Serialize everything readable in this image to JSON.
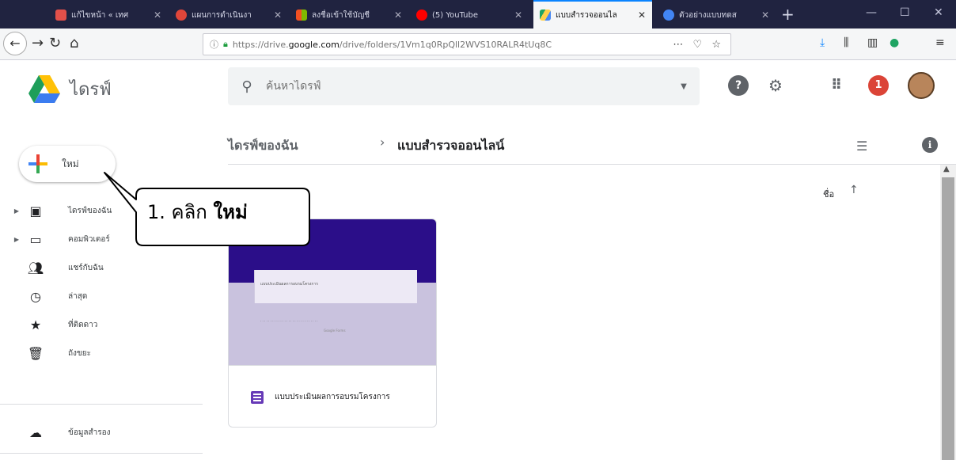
{
  "browser": {
    "tabs": [
      {
        "title": "แก้ไขหน้า « เทศ",
        "color": "#e2504a"
      },
      {
        "title": "แผนการดำเนินงา",
        "color": "#e0463a"
      },
      {
        "title": "ลงชื่อเข้าใช้บัญชี",
        "color": "#f4b400"
      },
      {
        "title": "(5) YouTube",
        "color": "#ff0000"
      },
      {
        "title": "แบบสำรวจออนไล",
        "color": "#1fa463"
      },
      {
        "title": "ตัวอย่างแบบทดส",
        "color": "#4285f4"
      }
    ],
    "url_prefix": "https://drive.",
    "url_domain": "google.com",
    "url_path": "/drive/folders/1Vm1q0RpQll2WVS10RALR4tUq8C"
  },
  "drive": {
    "brand": "ไดรฟ์",
    "search_placeholder": "ค้นหาไดรฟ์",
    "notification_count": "1",
    "new_button": "ใหม่",
    "sidebar": [
      {
        "label": "ไดรฟ์ของฉัน",
        "icon": "drive-icon"
      },
      {
        "label": "คอมพิวเตอร์",
        "icon": "computer-icon"
      },
      {
        "label": "แชร์กับฉัน",
        "icon": "people-icon"
      },
      {
        "label": "ล่าสุด",
        "icon": "clock-icon"
      },
      {
        "label": "ที่ติดดาว",
        "icon": "star-icon"
      },
      {
        "label": "ถังขยะ",
        "icon": "trash-icon"
      },
      {
        "label": "ข้อมูลสำรอง",
        "icon": "cloud-icon"
      }
    ],
    "breadcrumb_root": "ไดรฟ์ของฉัน",
    "breadcrumb_current": "แบบสำรวจออนไลน์",
    "sort_label": "ชื่อ",
    "file": {
      "name": "แบบประเมินผลการอบรมโครงการ",
      "preview_title": "แบบประเมินผลการอบรมโครงการ",
      "preview_footer": "Google Forms"
    }
  },
  "callout": {
    "prefix": "1. คลิก ",
    "bold": "ใหม่"
  }
}
